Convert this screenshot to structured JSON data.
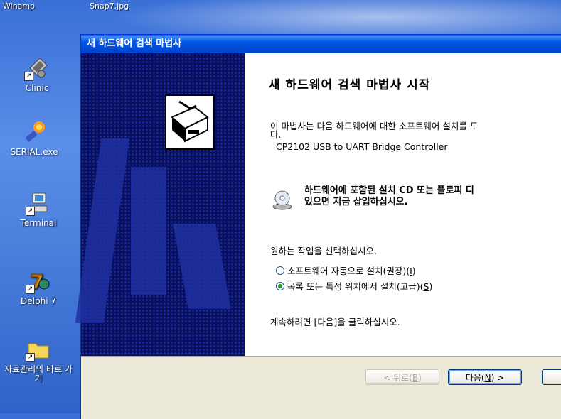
{
  "desktop": {
    "top_labels": [
      "Winamp",
      "Snap7.jpg"
    ],
    "icons": [
      {
        "label": "Clinic",
        "icon": "clinic-icon"
      },
      {
        "label": "SERIAL.exe",
        "icon": "serial-exe-icon"
      },
      {
        "label": "Terminal",
        "icon": "terminal-icon"
      },
      {
        "label": "Delphi 7",
        "icon": "delphi-icon"
      },
      {
        "label": "자료관리의 바로 가기",
        "icon": "folder-shortcut-icon"
      }
    ]
  },
  "wizard": {
    "title": "새 하드웨어 검색 마법사",
    "heading": "새 하드웨어 검색 마법사 시작",
    "intro": "이 마법사는 다음 하드웨어에 대한 소프트웨어 설치를 도",
    "intro_cont": "다.",
    "device": "CP2102 USB to UART Bridge Controller",
    "cd_line1": "하드웨어에 포함된 설치 CD 또는 플로피 디",
    "cd_line2": "있으면 지금 삽입하십시오.",
    "prompt": "원하는 작업을 선택하십시오.",
    "options": [
      {
        "label": "소프트웨어 자동으로 설치(권장)(",
        "key": "I",
        "end": ")",
        "selected": false
      },
      {
        "label": "목록 또는 특정 위치에서 설치(고급)(",
        "key": "S",
        "end": ")",
        "selected": true
      }
    ],
    "continue_text": "계속하려면 [다음]을 클릭하십시오.",
    "buttons": {
      "back": {
        "pre": "< 뒤로(",
        "key": "B",
        "post": ")"
      },
      "next": {
        "pre": "다음(",
        "key": "N",
        "post": ") >"
      }
    }
  }
}
